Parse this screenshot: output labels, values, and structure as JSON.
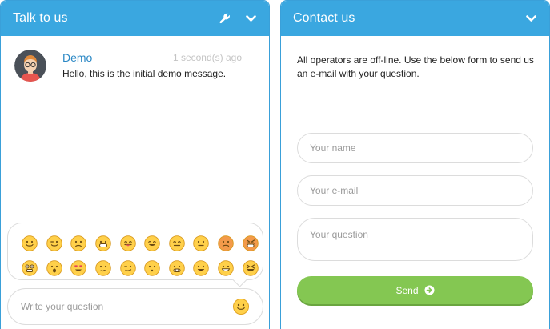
{
  "chat": {
    "title": "Talk to us",
    "message": {
      "author": "Demo",
      "time": "1 second(s) ago",
      "text": "Hello, this is the initial demo message."
    },
    "emoji_rows": [
      [
        "smile",
        "wink",
        "frown",
        "grin",
        "tongue",
        "happy",
        "neutral",
        "surprised",
        "angry",
        "furious"
      ],
      [
        "shocked",
        "scared",
        "heart-eyes",
        "worried",
        "smirk",
        "sad",
        "teeth",
        "laugh",
        "big-grin",
        "xd"
      ]
    ],
    "input_placeholder": "Write your question"
  },
  "contact": {
    "title": "Contact us",
    "offline_message": "All operators are off-line. Use the below form to send us an e-mail with your question.",
    "name_placeholder": "Your name",
    "email_placeholder": "Your e-mail",
    "question_placeholder": "Your question",
    "send_label": "Send"
  },
  "colors": {
    "header": "#3aa7e0",
    "author": "#2b88c5",
    "send": "#84c752",
    "emoji": "#ffd04a"
  },
  "icons": {
    "settings": "wrench-icon",
    "collapse": "chevron-down-icon",
    "send": "arrow-circle-right-icon"
  }
}
